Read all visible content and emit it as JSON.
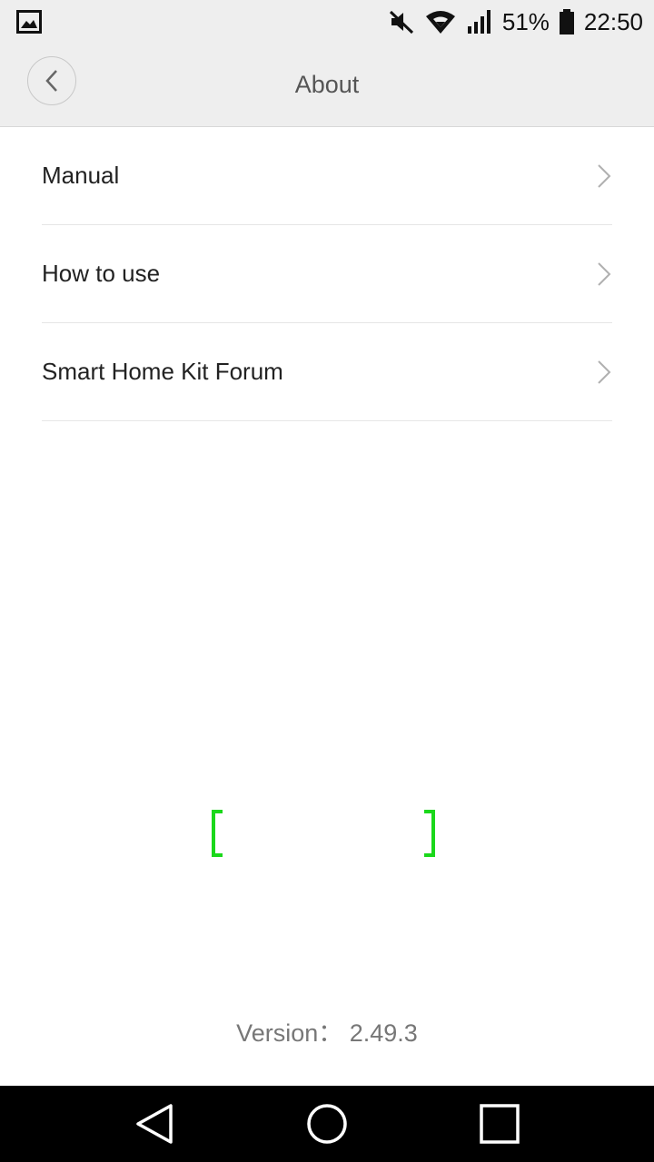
{
  "status_bar": {
    "battery_percent": "51%",
    "time": "22:50",
    "icons": [
      "gallery-icon",
      "mute-icon",
      "wifi-icon",
      "signal-icon",
      "battery-icon"
    ]
  },
  "header": {
    "title": "About",
    "back_icon": "chevron-left-icon"
  },
  "menu": {
    "items": [
      {
        "label": "Manual"
      },
      {
        "label": "How to use"
      },
      {
        "label": "Smart Home Kit Forum"
      }
    ]
  },
  "scanner": {
    "accent_color": "#1bd81b"
  },
  "footer": {
    "version": "Version： 2.49.3"
  },
  "nav_bar": {
    "icons": [
      "nav-back-icon",
      "nav-home-icon",
      "nav-recent-icon"
    ]
  }
}
